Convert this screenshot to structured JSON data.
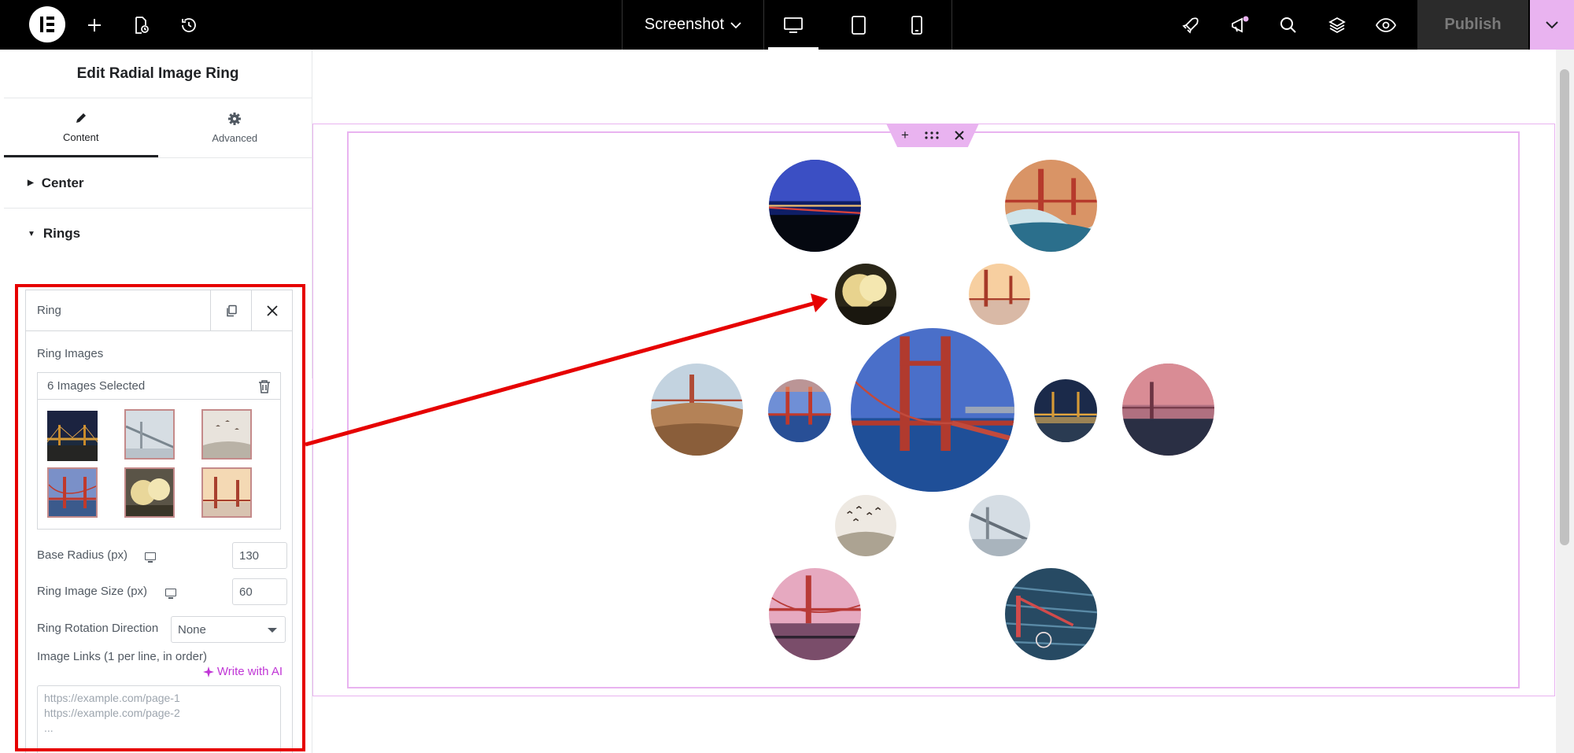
{
  "topbar": {
    "document_title": "Screenshot",
    "publish_label": "Publish"
  },
  "panel": {
    "header": "Edit Radial Image Ring",
    "tabs": [
      {
        "label": "Content",
        "icon": "pencil-icon"
      },
      {
        "label": "Advanced",
        "icon": "gear-icon"
      }
    ],
    "sections": {
      "center": "Center",
      "rings": "Rings"
    },
    "ring": {
      "title": "Ring",
      "images_label": "Ring Images",
      "images_selected": "6 Images Selected",
      "base_radius_label": "Base Radius (px)",
      "base_radius_value": "130",
      "image_size_label": "Ring Image Size (px)",
      "image_size_value": "60",
      "rotation_label": "Ring Rotation Direction",
      "rotation_value": "None",
      "links_label": "Image Links (1 per line, in order)",
      "write_ai": "Write with AI",
      "links_placeholder": "https://example.com/page-1\nhttps://example.com/page-2\n..."
    }
  },
  "colors": {
    "accent_pink": "#e9b3f0",
    "ai_purple": "#c036d6",
    "highlight_red": "#e60000"
  }
}
